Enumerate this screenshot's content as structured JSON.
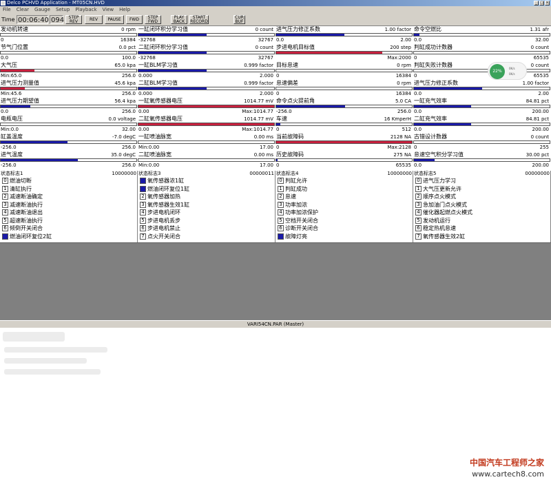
{
  "window": {
    "title": "Delco PCHVD Application - MT05CN.HVD"
  },
  "menu": [
    "File",
    "Clear",
    "Gauge",
    "Setup",
    "Playback",
    "View",
    "Help"
  ],
  "toolbar": {
    "time_label": "Time",
    "time_value": "00:06:40",
    "frame_value": "094",
    "buttons": [
      "STEP\nREV",
      "REV",
      "PAUSE",
      "FWD",
      "STEP\nFWD",
      "PLAY\nBACK",
      "START\nRECORD",
      "CUR\nBUF"
    ]
  },
  "params": [
    {
      "label": "发动机转速",
      "value": "0 rpm",
      "min": "0",
      "max": "16384",
      "fill": 0,
      "color": "#1a1aa8"
    },
    {
      "label": "一缸闭环积分学习值",
      "value": "0 count",
      "min": "-32768",
      "max": "32767",
      "fill": 0.5,
      "color": "#1a1aa8"
    },
    {
      "label": "进气压力修正系数",
      "value": "1.00 factor",
      "min": "0.0",
      "max": "2.00",
      "fill": 0.5,
      "color": "#1a1aa8"
    },
    {
      "label": "命令空燃比",
      "value": "1.31 afr",
      "min": "0.0",
      "max": "32.00",
      "fill": 0.04,
      "color": "#1a1aa8"
    },
    {
      "label": "节气门位置",
      "value": "0.0 pct",
      "min": "0.0",
      "max": "100.0",
      "fill": 0,
      "color": "#1a1aa8"
    },
    {
      "label": "二缸闭环积分学习值",
      "value": "0 count",
      "min": "-32768",
      "max": "32767",
      "fill": 0.5,
      "color": "#1a1aa8"
    },
    {
      "label": "步进电机目标值",
      "value": "200 step",
      "min": "",
      "max": "Max:2000",
      "fill": 0.78,
      "color": "#c8203e"
    },
    {
      "label": "判缸成功计数器",
      "value": "0 count",
      "min": "0",
      "max": "65535",
      "fill": 0,
      "color": "#1a1aa8"
    },
    {
      "label": "大气压",
      "value": "65.0 kpa",
      "min": "Min:65.0",
      "max": "256.0",
      "fill": 0.25,
      "color": "#c8203e"
    },
    {
      "label": "一缸BLM学习值",
      "value": "0.999 factor",
      "min": "0.000",
      "max": "2.000",
      "fill": 0.5,
      "color": "#1a1aa8"
    },
    {
      "label": "目标怠速",
      "value": "0 rpm",
      "min": "0",
      "max": "16384",
      "fill": 0,
      "color": "#1a1aa8"
    },
    {
      "label": "判缸失败计数器",
      "value": "0 count",
      "min": "0",
      "max": "65535",
      "fill": 0,
      "color": "#1a1aa8"
    },
    {
      "label": "进气压力测量值",
      "value": "45.6 kpa",
      "min": "Min:45.6",
      "max": "256.0",
      "fill": 0.18,
      "color": "#c8203e"
    },
    {
      "label": "二缸BLM学习值",
      "value": "0.999 factor",
      "min": "0.000",
      "max": "2.000",
      "fill": 0.5,
      "color": "#1a1aa8"
    },
    {
      "label": "怠速偏差",
      "value": "0 rpm",
      "min": "0",
      "max": "16384",
      "fill": 0,
      "color": "#1a1aa8"
    },
    {
      "label": "进气压力修正系数",
      "value": "1.00 factor",
      "min": "0.0",
      "max": "2.00",
      "fill": 0.5,
      "color": "#1a1aa8"
    },
    {
      "label": "进气压力期望值",
      "value": "56.4 kpa",
      "min": "0.0",
      "max": "256.0",
      "fill": 0.22,
      "color": "#1a1aa8"
    },
    {
      "label": "一缸氧传感器电压",
      "value": "1014.77 mV",
      "min": "0.00",
      "max": "Max:1014.77",
      "fill": 1,
      "color": "#c8203e"
    },
    {
      "label": "命令点火提前角",
      "value": "5.0 CA",
      "min": "-256.0",
      "max": "256.0",
      "fill": 0.51,
      "color": "#1a1aa8"
    },
    {
      "label": "一缸充气效率",
      "value": "84.81 pct",
      "min": "0.0",
      "max": "200.00",
      "fill": 0.42,
      "color": "#1a1aa8"
    },
    {
      "label": "电瓶电压",
      "value": "0.0 voltage",
      "min": "Min:0.0",
      "max": "32.00",
      "fill": 0,
      "color": "#1a1aa8"
    },
    {
      "label": "二缸氧传感器电压",
      "value": "1014.77 mV",
      "min": "0.00",
      "max": "Max:1014.77",
      "fill": 1,
      "color": "#c8203e"
    },
    {
      "label": "车速",
      "value": "16 KmperH",
      "min": "0",
      "max": "512",
      "fill": 0.03,
      "color": "#1a1aa8"
    },
    {
      "label": "二缸充气效率",
      "value": "84.81 pct",
      "min": "0.0",
      "max": "200.00",
      "fill": 0.42,
      "color": "#1a1aa8"
    },
    {
      "label": "缸盖温度",
      "value": "-7.0 degC",
      "min": "-256.0",
      "max": "256.0",
      "fill": 0.49,
      "color": "#1a1aa8"
    },
    {
      "label": "一缸喷油脉宽",
      "value": "0.00 ms",
      "min": "Min:0.00",
      "max": "17.00",
      "fill": 0,
      "color": "#1a1aa8"
    },
    {
      "label": "当前故障码",
      "value": "2128 NA",
      "min": "0",
      "max": "Max:2128",
      "fill": 1,
      "color": "#c8203e"
    },
    {
      "label": "古错设计数器",
      "value": "0 count",
      "min": "0",
      "max": "255",
      "fill": 0,
      "color": "#1a1aa8"
    },
    {
      "label": "进气温度",
      "value": "35.0 degC",
      "min": "-256.0",
      "max": "256.0",
      "fill": 0.57,
      "color": "#1a1aa8"
    },
    {
      "label": "二缸喷油脉宽",
      "value": "0.00 ms",
      "min": "Min:0.00",
      "max": "17.00",
      "fill": 0,
      "color": "#1a1aa8"
    },
    {
      "label": "历史故障码",
      "value": "275 NA",
      "min": "0",
      "max": "65535",
      "fill": 0.01,
      "color": "#1a1aa8"
    },
    {
      "label": "怠速空气积分学习值",
      "value": "30.00 pct",
      "min": "0.0",
      "max": "200.00",
      "fill": 0.15,
      "color": "#1a1aa8"
    }
  ],
  "status_groups": [
    {
      "title": "状态标志1",
      "value": "10000000",
      "rows": [
        {
          "bit": "0",
          "label": "燃油切断",
          "on": false
        },
        {
          "bit": "1",
          "label": "清缸执行",
          "on": false
        },
        {
          "bit": "2",
          "label": "减速断油确定",
          "on": false
        },
        {
          "bit": "3",
          "label": "减速断油执行",
          "on": false
        },
        {
          "bit": "4",
          "label": "减速断油退出",
          "on": false
        },
        {
          "bit": "5",
          "label": "超速断油执行",
          "on": false
        },
        {
          "bit": "6",
          "label": "倾倒开关闭合",
          "on": false
        },
        {
          "bit": "7",
          "label": "燃油闭环复位2缸",
          "on": true
        }
      ]
    },
    {
      "title": "状态标志3",
      "value": "00000011",
      "rows": [
        {
          "bit": "0",
          "label": "氧传感器浓1缸",
          "on": true
        },
        {
          "bit": "1",
          "label": "燃油闭环复位1缸",
          "on": true
        },
        {
          "bit": "2",
          "label": "氧传感器加热",
          "on": false
        },
        {
          "bit": "3",
          "label": "氧传感器生效1缸",
          "on": false
        },
        {
          "bit": "4",
          "label": "步进电机闭环",
          "on": false
        },
        {
          "bit": "5",
          "label": "步进电机丢步",
          "on": false
        },
        {
          "bit": "6",
          "label": "步进电机禁止",
          "on": false
        },
        {
          "bit": "7",
          "label": "点火开关闭合",
          "on": false
        }
      ]
    },
    {
      "title": "状态标志4",
      "value": "10000000",
      "rows": [
        {
          "bit": "0",
          "label": "判缸允许",
          "on": false
        },
        {
          "bit": "1",
          "label": "判缸成功",
          "on": false
        },
        {
          "bit": "2",
          "label": "怠速",
          "on": false
        },
        {
          "bit": "3",
          "label": "功率加浓",
          "on": false
        },
        {
          "bit": "4",
          "label": "功率加浓保护",
          "on": false
        },
        {
          "bit": "5",
          "label": "空档开关闭合",
          "on": false
        },
        {
          "bit": "6",
          "label": "诊断开关闭合",
          "on": false
        },
        {
          "bit": "7",
          "label": "故障灯亮",
          "on": true
        }
      ]
    },
    {
      "title": "状态标志5",
      "value": "00000000",
      "rows": [
        {
          "bit": "0",
          "label": "进气压力学习",
          "on": false
        },
        {
          "bit": "1",
          "label": "大气压更新允许",
          "on": false
        },
        {
          "bit": "2",
          "label": "顺序点火模式",
          "on": false
        },
        {
          "bit": "3",
          "label": "急加油门点火模式",
          "on": false
        },
        {
          "bit": "4",
          "label": "催化器起燃点火模式",
          "on": false
        },
        {
          "bit": "5",
          "label": "发动机运行",
          "on": false
        },
        {
          "bit": "6",
          "label": "稳定热机怠速",
          "on": false
        },
        {
          "bit": "7",
          "label": "氧传感器生效2缸",
          "on": false
        }
      ]
    }
  ],
  "statusbar": {
    "text": "VARI54CN.PAR (Master)"
  },
  "gauge": {
    "percent": "22%",
    "line1": "0K/s",
    "line2": "0K/s"
  },
  "watermark": {
    "cn": "中国汽车工程师之家",
    "url": "www.cartech8.com"
  }
}
